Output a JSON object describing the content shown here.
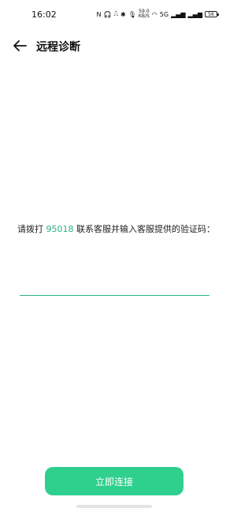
{
  "status_bar": {
    "time": "16:02",
    "network_speed_value": "59.0",
    "network_speed_unit": "KB/S",
    "net_type": "5G",
    "battery": "56"
  },
  "app_bar": {
    "title": "远程诊断"
  },
  "instruction": {
    "prefix": "请拨打 ",
    "phone": "95018",
    "suffix": " 联系客服并输入客服提供的验证码："
  },
  "code_input": {
    "value": "",
    "placeholder": ""
  },
  "connect_button": {
    "label": "立即连接"
  },
  "colors": {
    "accent": "#2fcf8e",
    "link": "#2ab384"
  }
}
